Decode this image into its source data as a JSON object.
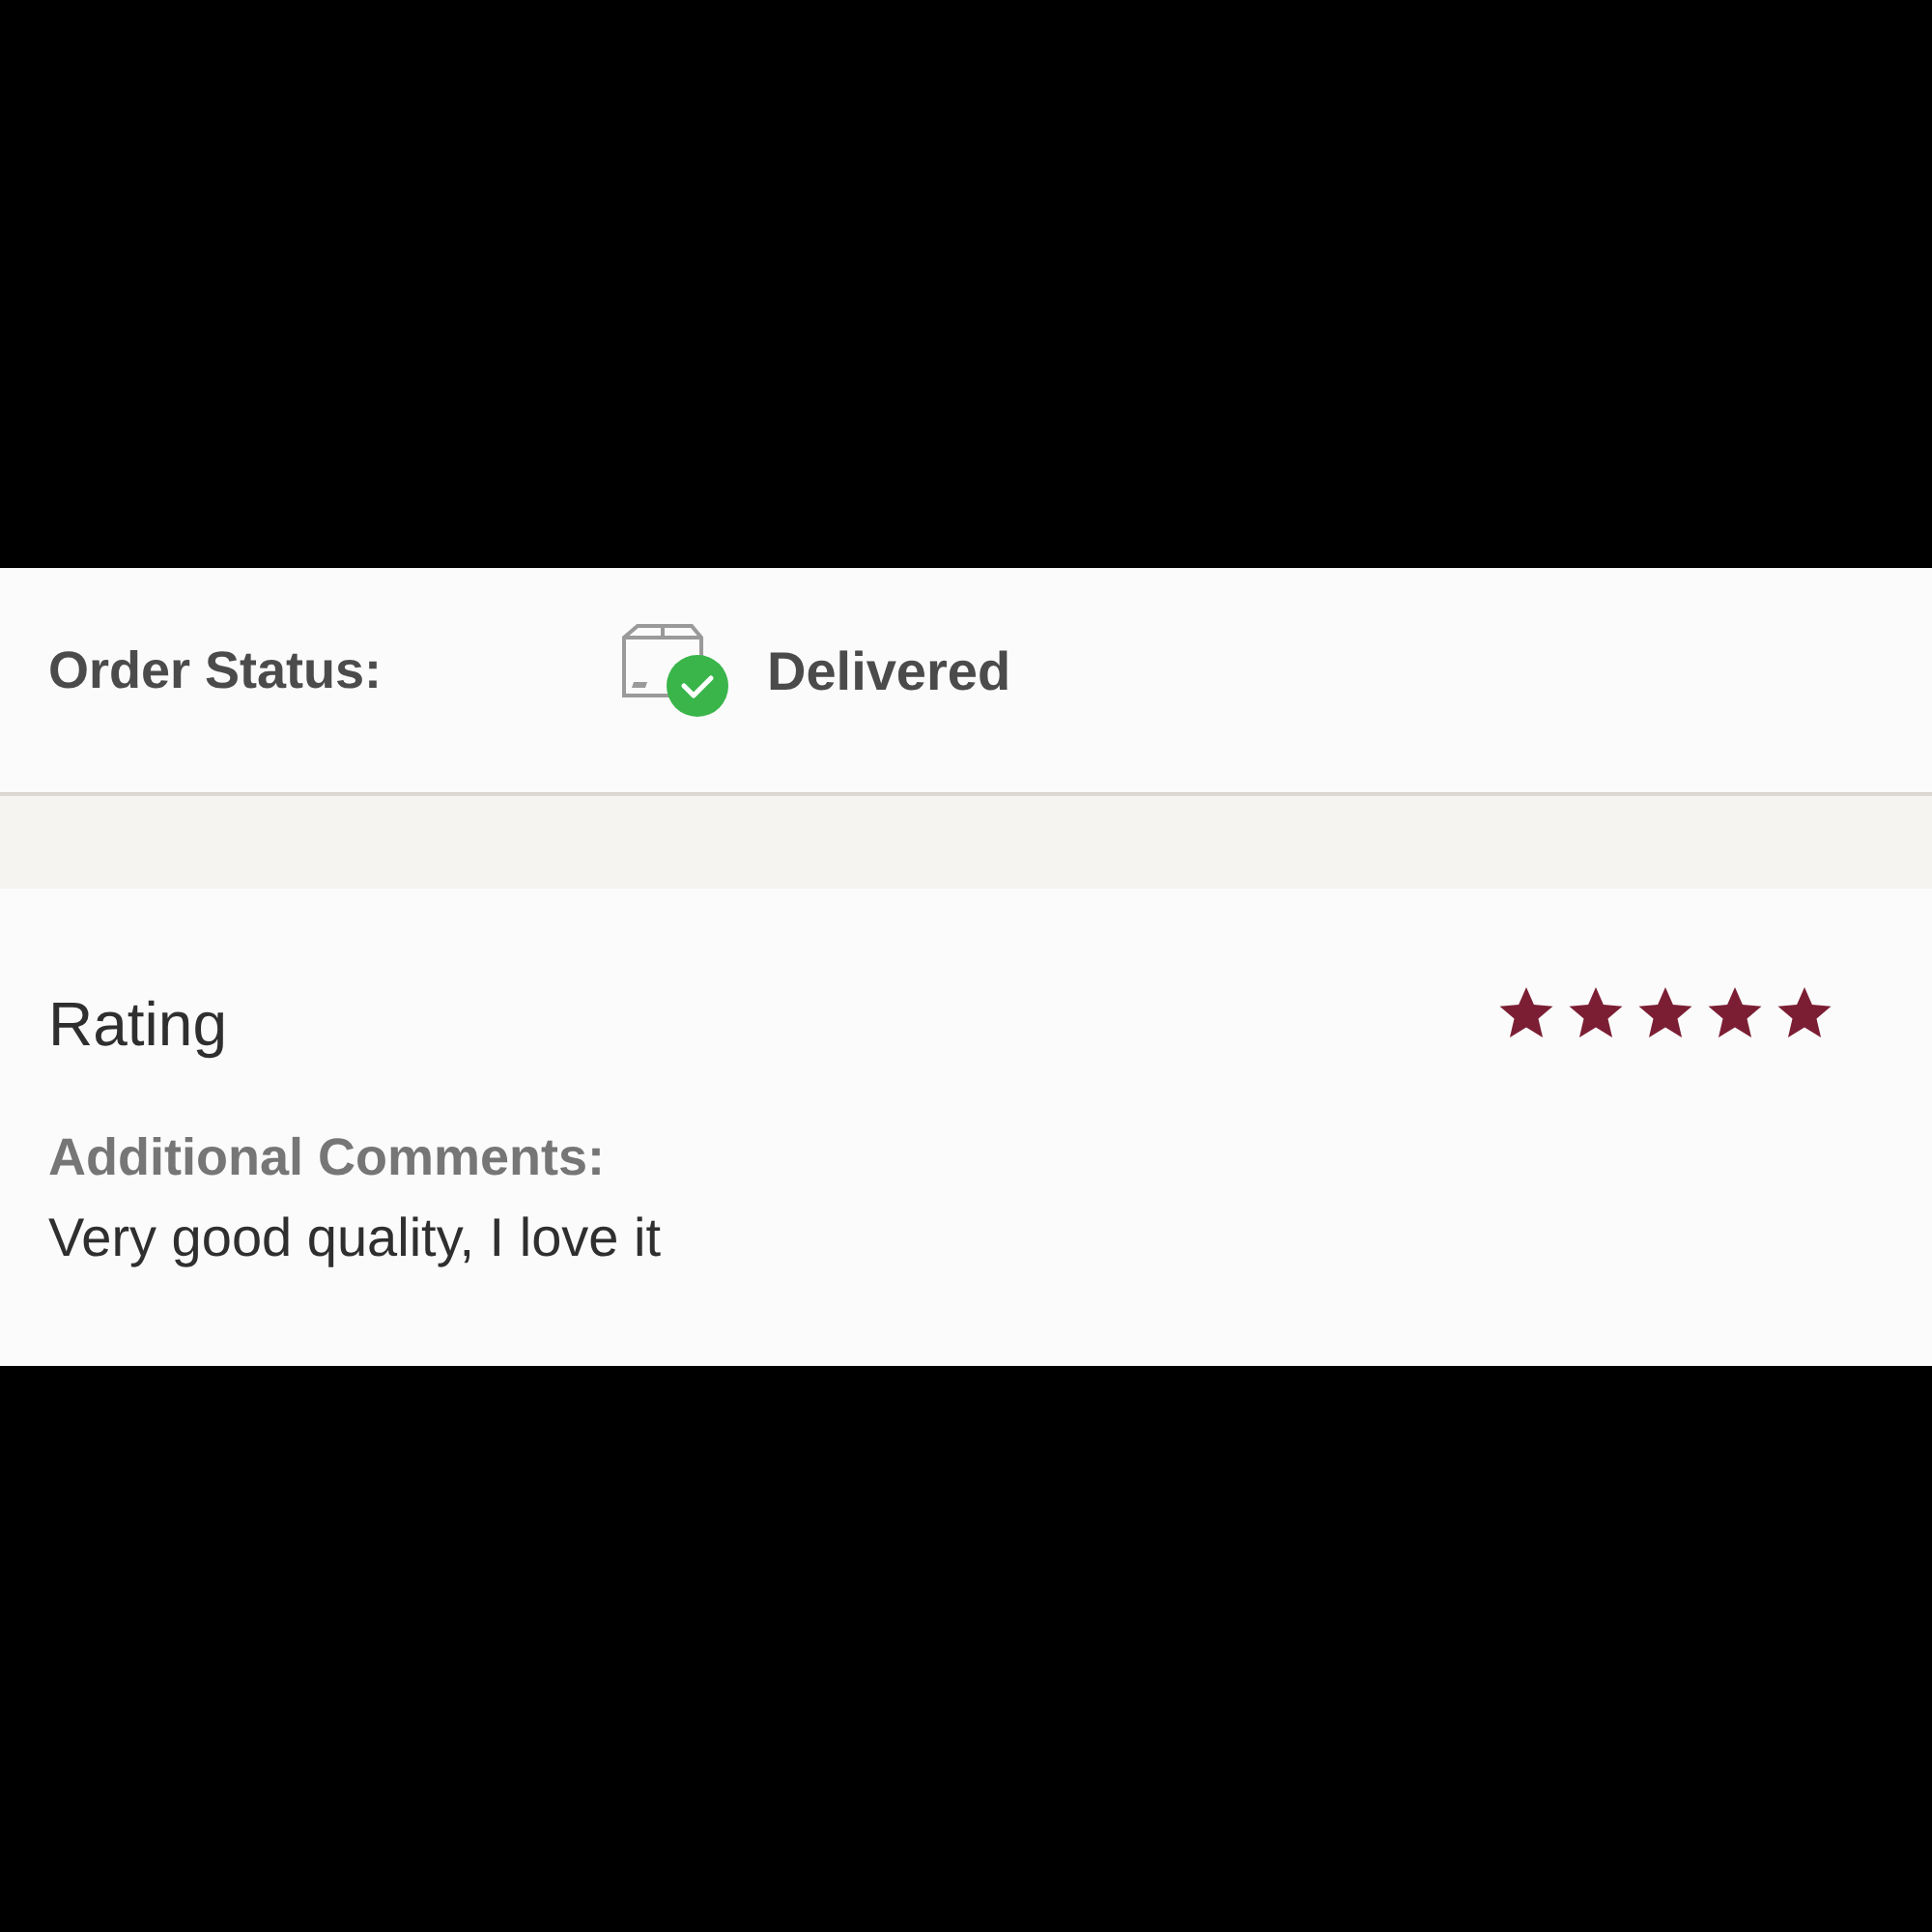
{
  "order_status": {
    "label": "Order Status:",
    "value": "Delivered"
  },
  "rating": {
    "title": "Rating",
    "stars": 5,
    "comments_label": "Additional Comments:",
    "comment": "Very good quality, I love it"
  }
}
